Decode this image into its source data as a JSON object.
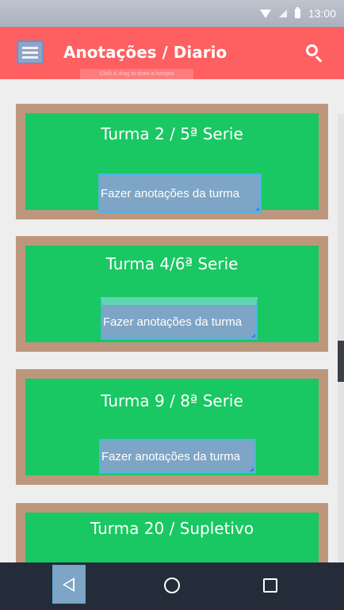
{
  "status_bar": {
    "time": "13:00",
    "icons": [
      "wifi-icon",
      "signal-icon",
      "battery-icon"
    ]
  },
  "app_bar": {
    "title": "Anotações / Diario",
    "hotspot_hint": "Click & drag to draw a hotspot",
    "menu_icon": "hamburger-menu-icon",
    "search_icon": "search-icon"
  },
  "cards": [
    {
      "title": "Turma 2 / 5ª Serie",
      "button": "Fazer anotações da turma"
    },
    {
      "title": "Turma 4/6ª Serie",
      "button": "Fazer anotações da turma"
    },
    {
      "title": "Turma 9 / 8ª Serie",
      "button": "Fazer anotações da turma"
    },
    {
      "title": "Turma 20 /  Supletivo",
      "button": ""
    }
  ],
  "nav_bar": {
    "icons": [
      "back-icon",
      "home-icon",
      "recent-apps-icon"
    ]
  },
  "colors": {
    "app_bar": "#fe6062",
    "card_frame": "#bd967e",
    "card_fill": "#19c862",
    "button_fill": "#7ea5c5",
    "nav_bar": "#232c38"
  }
}
